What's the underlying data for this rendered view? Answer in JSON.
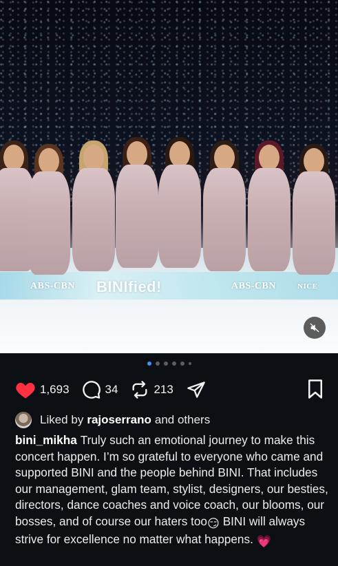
{
  "media": {
    "watermarks": [
      "ABS-CBN",
      "BINIfied!",
      "ABS-CBN",
      "NICE"
    ],
    "mute_icon": "speaker-muted-icon"
  },
  "carousel": {
    "count": 6,
    "active_index": 0
  },
  "actions": {
    "likes": "1,693",
    "comments": "34",
    "reposts": "213",
    "like_color": "#ff3040"
  },
  "liked_by": {
    "prefix": "Liked by",
    "user": "rajoserrano",
    "suffix": "and others"
  },
  "caption": {
    "username": "bini_mikha",
    "text_part1": "Truly such an emotional journey to make this concert happen.  I’m so grateful to everyone who came and supported BINI and the people behind BINI. That includes our management, glam team, stylist, designers, our besties, directors, dance coaches and voice coach, our blooms, our bosses, and of course our haters too",
    "emoji1": "😏",
    "text_part2": " BINI will always strive for excellence no matter what happens. ",
    "emoji2": "💗"
  }
}
